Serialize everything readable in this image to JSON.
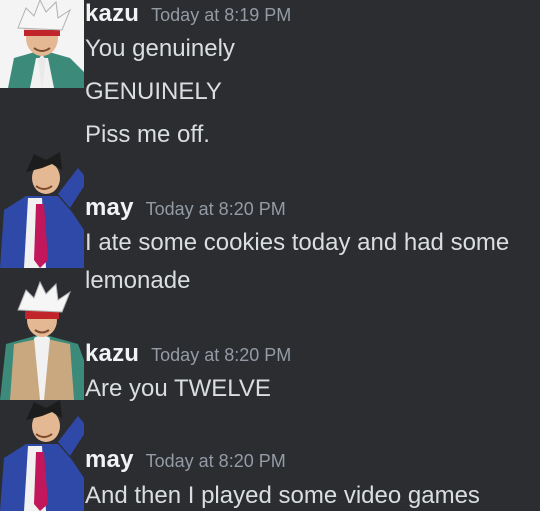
{
  "colors": {
    "background": "#2b2d31",
    "username": "#f2f3f5",
    "timestamp": "#949ba4",
    "message_text": "#dbdee1"
  },
  "messages": [
    {
      "username": "kazu",
      "timestamp": "Today at 8:19 PM",
      "avatar": "white-haired-prosecutor-avatar",
      "lines": [
        "You genuinely",
        "GENUINELY",
        "Piss me off."
      ]
    },
    {
      "username": "may",
      "timestamp": "Today at 8:20 PM",
      "avatar": "blue-suit-attorney-avatar",
      "lines": [
        "I ate some cookies today and had some",
        "lemonade"
      ]
    },
    {
      "username": "kazu",
      "timestamp": "Today at 8:20 PM",
      "avatar": "white-haired-prosecutor-avatar",
      "lines": [
        "Are you TWELVE"
      ]
    },
    {
      "username": "may",
      "timestamp": "Today at 8:20 PM",
      "avatar": "blue-suit-attorney-avatar",
      "lines": [
        "And then I played some video games"
      ]
    }
  ]
}
